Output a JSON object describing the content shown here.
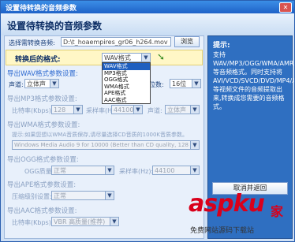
{
  "window": {
    "title": "设置待转换的音频参数",
    "header": "设置待转换的音频参数"
  },
  "file": {
    "label": "选择需转换音频:",
    "value": "D:\\t_hoaempires_gr06_h264.mov",
    "browse_label": "浏览"
  },
  "format": {
    "label": "转换后的格式:",
    "selected": "WAV格式",
    "options": [
      "WAV格式",
      "MP3格式",
      "OGG格式",
      "WMA格式",
      "APE格式",
      "AAC格式"
    ],
    "highlighted_index": 0
  },
  "wav": {
    "section": "导出WAV格式参数设置:",
    "channel_label": "声道:",
    "channel_value": "立体声",
    "sample_rate_value": "44100",
    "bits_label": "位数:",
    "bits_value": "16位"
  },
  "mp3": {
    "section": "导出MP3格式参数设置:",
    "bitrate_label": "比特率(Kbps):",
    "bitrate_value": "128",
    "sample_label": "采样率(Hz):",
    "sample_value": "44100",
    "channel_label": "声道:",
    "channel_value": "立体声"
  },
  "wma": {
    "section": "导出WMA格式参数设置:",
    "hint": "提示:如果您想以WMA音质保存,请尽量选择CD音质的1000K音质参数。",
    "value": "Windows Media Audio 9 for 10000 (Better than CD quality, 128 Kbps)"
  },
  "ogg": {
    "section": "导出OGG格式参数设置:",
    "quality_label": "OGG质量:",
    "quality_value": "正常",
    "sample_label": "采样率(Hz):",
    "sample_value": "44100"
  },
  "ape": {
    "section": "导出APE格式参数设置:",
    "level_label": "压缩级别设置:",
    "level_value": "正常"
  },
  "aac": {
    "section": "导出AAC格式参数设置:",
    "bitrate_label": "比特率(Kbps):",
    "bitrate_value": "VBR 高质量(推荐)"
  },
  "buttons": {
    "cancel_label": "取消并返回"
  },
  "tip": {
    "title": "提示:",
    "text": "支持WAV/MP3/OGG/WMA/AMR/APE/AAC/AC3等音频格式。同时支持将AVI/VCD/SVCD/DVD/MP4/ASF/FLV等视频文件的音频提取出来,转换成您需要的音频格式。"
  },
  "watermark": {
    "text_main": "aspku",
    "text_cn": "家",
    "text_sub": "免费网站源码下载站"
  },
  "colors": {
    "accent": "#2e6ad0",
    "panel_blue": "#2f6fc1",
    "watermark_red": "#d9001b"
  }
}
